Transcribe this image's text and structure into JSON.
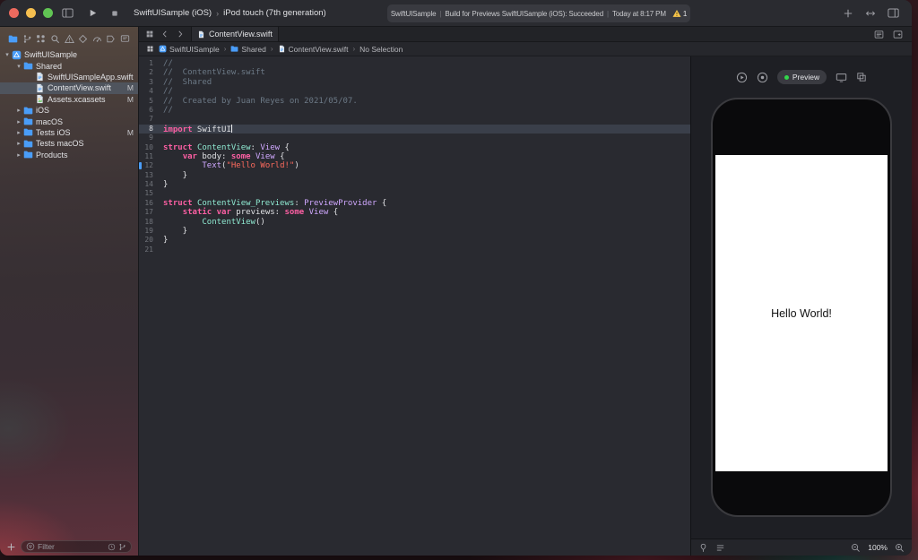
{
  "toolbar": {
    "scheme_app": "SwiftUISample (iOS)",
    "scheme_device": "iPod touch (7th generation)",
    "chevron_sep": "›",
    "status_project": "SwiftUISample",
    "status_divider": "|",
    "status_message": "Build for Previews SwiftUISample (iOS): Succeeded",
    "status_time": "Today at 8:17 PM",
    "warning_count": "1"
  },
  "colors": {
    "accent_blue": "#4a9df8",
    "traffic_close": "#ec6a5e",
    "traffic_minimize": "#f5bf4f",
    "traffic_zoom": "#61c554",
    "preview_running_green": "#32d74b",
    "keyword_pink": "#fc5fa3",
    "string_red": "#fc6a5d",
    "comment_gray": "#6c7986"
  },
  "icon_glyphs": {
    "toggle_navigator": "sidebar-left",
    "run": "play",
    "stop": "stop",
    "library": "plus",
    "editor_arrows": "arrows-lr",
    "toggle_inspector": "sidebar-right",
    "related_items": "grid",
    "back": "chevron-left",
    "forward": "chevron-right",
    "editor_options": "editor-options",
    "add_editor": "add-editor",
    "tab_file": "swift",
    "live_preview": "play-circle",
    "preview_on_device": "dot-circle",
    "preview_device_select": "monitor",
    "preview_inspect": "inspect",
    "pin": "pin",
    "preview_list": "list",
    "zoom_out": "zoom-out",
    "zoom_in": "zoom-in",
    "filter": "filter",
    "recents": "clock",
    "field_branch": "branch",
    "warning": "warning-fill",
    "add": "plus"
  },
  "disclosure": {
    "down": "▾",
    "right": "▸"
  },
  "navigator": {
    "strip": [
      {
        "name": "project-navigator",
        "glyph": "folder",
        "active": true
      },
      {
        "name": "source-control-navigator",
        "glyph": "branch"
      },
      {
        "name": "symbol-navigator",
        "glyph": "symbols"
      },
      {
        "name": "find-navigator",
        "glyph": "find"
      },
      {
        "name": "issue-navigator",
        "glyph": "issues"
      },
      {
        "name": "test-navigator",
        "glyph": "tests"
      },
      {
        "name": "debug-navigator",
        "glyph": "debug"
      },
      {
        "name": "breakpoint-navigator",
        "glyph": "breakpoints"
      },
      {
        "name": "report-navigator",
        "glyph": "reports"
      }
    ],
    "tree": [
      {
        "label": "SwiftUISample",
        "level": 0,
        "icon": "app",
        "chevron": "down"
      },
      {
        "label": "Shared",
        "level": 1,
        "icon": "folder",
        "chevron": "down"
      },
      {
        "label": "SwiftUISampleApp.swift",
        "level": 2,
        "icon": "swift"
      },
      {
        "label": "ContentView.swift",
        "level": 2,
        "icon": "swift",
        "badge": "M",
        "selected": true
      },
      {
        "label": "Assets.xcassets",
        "level": 2,
        "icon": "assets",
        "badge": "M"
      },
      {
        "label": "iOS",
        "level": 1,
        "icon": "folder",
        "chevron": "right"
      },
      {
        "label": "macOS",
        "level": 1,
        "icon": "folder",
        "chevron": "right"
      },
      {
        "label": "Tests iOS",
        "level": 1,
        "icon": "folder",
        "chevron": "right",
        "badge": "M"
      },
      {
        "label": "Tests macOS",
        "level": 1,
        "icon": "folder",
        "chevron": "right"
      },
      {
        "label": "Products",
        "level": 1,
        "icon": "folder",
        "chevron": "right"
      }
    ],
    "filter_placeholder": "Filter"
  },
  "editor": {
    "tab_title": "ContentView.swift",
    "breadcrumb_separator": "›",
    "breadcrumbs": [
      {
        "label": "SwiftUISample",
        "glyph": "app"
      },
      {
        "label": "Shared",
        "glyph": "folder"
      },
      {
        "label": "ContentView.swift",
        "glyph": "swift"
      },
      {
        "label": "No Selection"
      }
    ],
    "lines": [
      {
        "n": 1,
        "tokens": [
          [
            "c",
            "//"
          ]
        ]
      },
      {
        "n": 2,
        "tokens": [
          [
            "c",
            "//  ContentView.swift"
          ]
        ]
      },
      {
        "n": 3,
        "tokens": [
          [
            "c",
            "//  Shared"
          ]
        ]
      },
      {
        "n": 4,
        "tokens": [
          [
            "c",
            "//"
          ]
        ]
      },
      {
        "n": 5,
        "tokens": [
          [
            "c",
            "//  Created by Juan Reyes on 2021/05/07."
          ]
        ]
      },
      {
        "n": 6,
        "tokens": [
          [
            "c",
            "//"
          ]
        ]
      },
      {
        "n": 7,
        "tokens": []
      },
      {
        "n": 8,
        "tokens": [
          [
            "k",
            "import"
          ],
          [
            "p",
            " SwiftUI"
          ]
        ],
        "current": true,
        "cursor": true
      },
      {
        "n": 9,
        "tokens": []
      },
      {
        "n": 10,
        "tokens": [
          [
            "k",
            "struct"
          ],
          [
            "p",
            " "
          ],
          [
            "t",
            "ContentView"
          ],
          [
            "p",
            ": "
          ],
          [
            "s",
            "View"
          ],
          [
            "p",
            " {"
          ]
        ]
      },
      {
        "n": 11,
        "tokens": [
          [
            "p",
            "    "
          ],
          [
            "k",
            "var"
          ],
          [
            "p",
            " body: "
          ],
          [
            "k",
            "some"
          ],
          [
            "p",
            " "
          ],
          [
            "s",
            "View"
          ],
          [
            "p",
            " {"
          ]
        ]
      },
      {
        "n": 12,
        "tokens": [
          [
            "p",
            "        "
          ],
          [
            "s",
            "Text"
          ],
          [
            "p",
            "("
          ],
          [
            "str",
            "\"Hello World!\""
          ],
          [
            "p",
            ")"
          ]
        ],
        "marker": true
      },
      {
        "n": 13,
        "tokens": [
          [
            "p",
            "    }"
          ]
        ]
      },
      {
        "n": 14,
        "tokens": [
          [
            "p",
            "}"
          ]
        ]
      },
      {
        "n": 15,
        "tokens": []
      },
      {
        "n": 16,
        "tokens": [
          [
            "k",
            "struct"
          ],
          [
            "p",
            " "
          ],
          [
            "t",
            "ContentView_Previews"
          ],
          [
            "p",
            ": "
          ],
          [
            "s",
            "PreviewProvider"
          ],
          [
            "p",
            " {"
          ]
        ]
      },
      {
        "n": 17,
        "tokens": [
          [
            "p",
            "    "
          ],
          [
            "k",
            "static"
          ],
          [
            "p",
            " "
          ],
          [
            "k",
            "var"
          ],
          [
            "p",
            " previews: "
          ],
          [
            "k",
            "some"
          ],
          [
            "p",
            " "
          ],
          [
            "s",
            "View"
          ],
          [
            "p",
            " {"
          ]
        ]
      },
      {
        "n": 18,
        "tokens": [
          [
            "p",
            "        "
          ],
          [
            "t",
            "ContentView"
          ],
          [
            "p",
            "()"
          ]
        ]
      },
      {
        "n": 19,
        "tokens": [
          [
            "p",
            "    }"
          ]
        ]
      },
      {
        "n": 20,
        "tokens": [
          [
            "p",
            "}"
          ]
        ]
      },
      {
        "n": 21,
        "tokens": []
      }
    ]
  },
  "preview": {
    "status_label": "Preview",
    "screen_text": "Hello World!",
    "zoom_level": "100%"
  }
}
